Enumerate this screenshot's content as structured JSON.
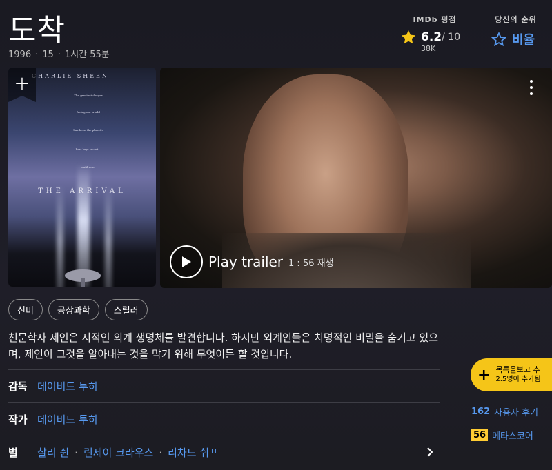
{
  "title": "도착",
  "meta": {
    "year": "1996",
    "rating": "15",
    "runtime": "1시간 55분",
    "sep": "·"
  },
  "imdb": {
    "label": "IMDb 평점",
    "score": "6.2",
    "max": "/ 10",
    "count": "38K"
  },
  "your_rating": {
    "label": "당신의 순위",
    "action": "비율"
  },
  "poster": {
    "actor_name": "CHARLIE SHEEN",
    "title": "THE ARRIVAL",
    "taglines": [
      "The greatest danger",
      "facing our world",
      "has been the planet's",
      "best kept secret...",
      "until now."
    ],
    "add_label": "+"
  },
  "video": {
    "play_label": "Play trailer",
    "duration": "1 : 56",
    "play_suffix": "재생"
  },
  "genres": [
    "신비",
    "공상과학",
    "스릴러"
  ],
  "plot": "천문학자 제인은 지적인 외계 생명체를 발견합니다. 하지만 외계인들은 치명적인 비밀을 숨기고 있으며, 제인이 그것을 알아내는 것을 막기 위해 무엇이든 할 것입니다.",
  "credits": {
    "director": {
      "label": "감독",
      "names": [
        "데이비드 투히"
      ]
    },
    "writer": {
      "label": "작가",
      "names": [
        "데이비드 투히"
      ]
    },
    "stars": {
      "label": "별",
      "names": [
        "찰리 쉰",
        "린제이 크라우스",
        "리차드 쉬프"
      ]
    }
  },
  "watchlist": {
    "plus": "+",
    "line1": "목록을보고 추",
    "line2": "2.5명이 추가됨"
  },
  "stats": {
    "user_reviews": {
      "count": "162",
      "label": "사용자 후기"
    },
    "metascore": {
      "score": "56",
      "label": "메타스코어"
    }
  },
  "colors": {
    "accent": "#f5c518",
    "link": "#5799ef",
    "background": "#1c1c22"
  }
}
